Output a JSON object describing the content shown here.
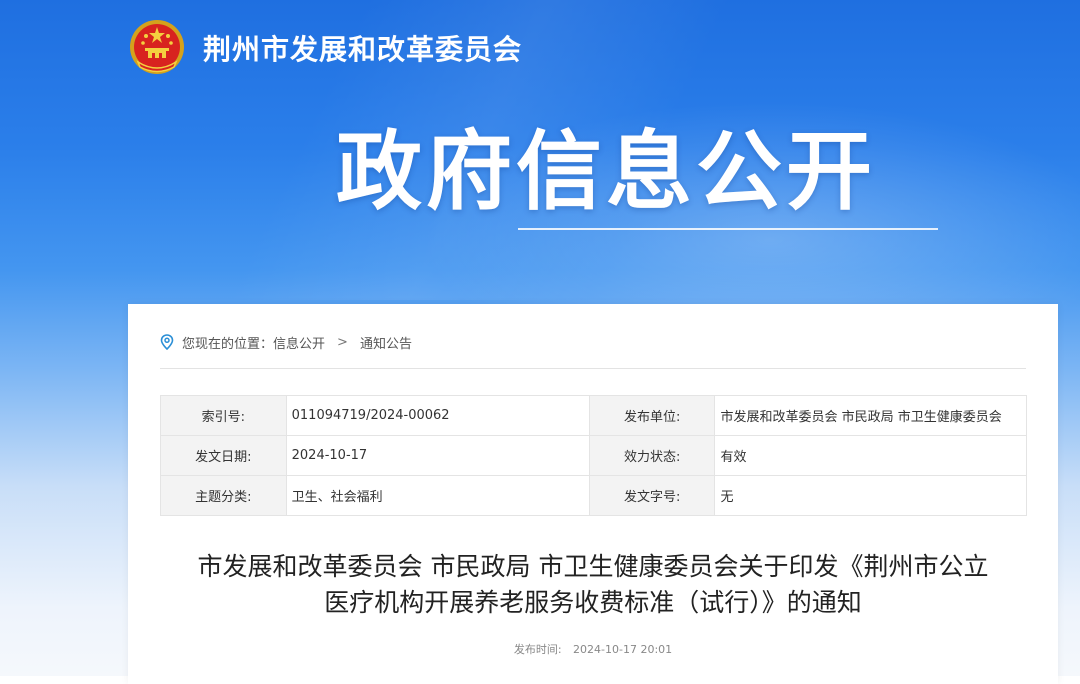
{
  "header": {
    "site_name": "荆州市发展和改革委员会",
    "emblem_icon": "national-emblem-icon",
    "banner_title": "政府信息公开",
    "banner_color_top": "#1f6fe0",
    "banner_color_bottom": "#f5f8fc"
  },
  "breadcrumb": {
    "prefix": "您现在的位置：",
    "icon": "location-pin-icon",
    "items": [
      "信息公开",
      "通知公告"
    ],
    "separator": ">"
  },
  "meta": {
    "rows": [
      [
        {
          "label": "索引号:",
          "value": "011094719/2024-00062"
        },
        {
          "label": "发布单位:",
          "value": "市发展和改革委员会 市民政局 市卫生健康委员会"
        }
      ],
      [
        {
          "label": "发文日期:",
          "value": "2024-10-17"
        },
        {
          "label": "效力状态:",
          "value": "有效"
        }
      ],
      [
        {
          "label": "主题分类:",
          "value": "卫生、社会福利"
        },
        {
          "label": "发文字号:",
          "value": "无"
        }
      ]
    ]
  },
  "document": {
    "title_line1": "市发展和改革委员会 市民政局 市卫生健康委员会关于印发《荆州市公立",
    "title_line2": "医疗机构开展养老服务收费标准（试行）》的通知",
    "publish_label": "发布时间:",
    "publish_time": "2024-10-17 20:01"
  }
}
